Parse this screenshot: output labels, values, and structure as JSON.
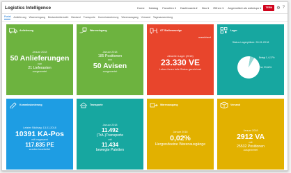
{
  "app": {
    "title": "Logistics Intelligence"
  },
  "topnav": [
    "Home",
    "Katalog",
    "Favoriten ▾",
    "Dashboards ▾",
    "Neu ▾",
    "Öffnen ▾"
  ],
  "user": "Angemeldet als  webdupo ▾",
  "logo": "TERN",
  "tabs": [
    "Portal",
    "Anlieferung",
    "Wareneingang",
    "Bestandsübersicht",
    "Bestand",
    "Transporte",
    "Kommissionierung",
    "Warenausgang",
    "Versand",
    "Tagesauswertung"
  ],
  "tiles": {
    "anlieferung": {
      "title": "Anlieferung",
      "period": "Januar 2018",
      "big1": "50 Anlieferungen",
      "word": "von",
      "m2": "21 Lieferanten",
      "s2": "ausgewertet"
    },
    "wareneingang": {
      "title": "Wareneingang",
      "period": "Januar 2018",
      "m1": "185 Positionen",
      "word": "aus",
      "big1": "50 Avisen",
      "s2": "ausgewertet"
    },
    "bestand": {
      "title": "GT Stellenanzeige",
      "status": "ausreichend",
      "s1": "Aktueller Lager (2018)",
      "big1": "23.330 VE",
      "s2": "Leben ihnen tolle Status gezeichnet"
    },
    "lager": {
      "title": "Lager",
      "subtitle": "Status Lagerplätze: 26.01.2018",
      "legend": [
        "Belegt 1, 6,17%",
        "Frei, 93,46%"
      ]
    },
    "kommissionierung": {
      "title": "Kommissionierung",
      "s1": "Letzter Stichtag: 13.01.2018",
      "big1": "10391 KA-Pos",
      "s2": "mit insgesamt",
      "med1": "117.835 PE",
      "s3": "wurden bearbeitet"
    },
    "transporte": {
      "title": "Transporte",
      "period": "Januar 2018",
      "med1": "11.492",
      "m1": "(TrA-)Transporte",
      "word": "mit",
      "med2": "11.434",
      "m2": "bewegte Paletten"
    },
    "warenausgang": {
      "title": "Warenausgang",
      "period": "Januar 2018",
      "big1": "0,02%",
      "m1": "Hergorufeeine Warenausgänge"
    },
    "versand": {
      "title": "Versand",
      "period": "Januar 2018",
      "big1": "2912 VA",
      "word": "mit",
      "m2": "25532 Positionen",
      "s2": "ausgewertet"
    }
  },
  "chart_data": {
    "type": "pie",
    "title": "Status Lagerplätze: 26.01.2018",
    "slices": [
      {
        "label": "Belegt 1",
        "value": 6.17
      },
      {
        "label": "Frei",
        "value": 93.46
      }
    ]
  },
  "colors": {
    "green": "#6db33f",
    "red": "#e8452c",
    "teal": "#17a7a0",
    "blue": "#1e9de3",
    "yellow": "#e2b100"
  }
}
